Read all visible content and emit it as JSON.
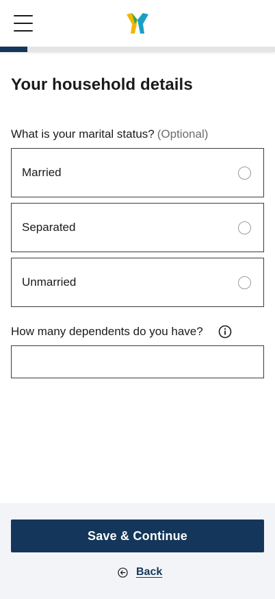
{
  "header": {
    "menu_icon": "hamburger-menu-icon",
    "logo_icon": "brand-logo-icon",
    "progress_fraction": 0.1
  },
  "page": {
    "title": "Your household details"
  },
  "marital": {
    "question": "What is your marital status?",
    "optional": "(Optional)",
    "options": [
      {
        "label": "Married",
        "selected": false
      },
      {
        "label": "Separated",
        "selected": false
      },
      {
        "label": "Unmarried",
        "selected": false
      }
    ]
  },
  "dependents": {
    "question": "How many dependents do you have?",
    "info_icon": "info-icon",
    "value": ""
  },
  "footer": {
    "save_label": "Save & Continue",
    "back_label": "Back",
    "back_icon": "back-arrow-circle-icon"
  },
  "colors": {
    "primary": "#14365a",
    "logo_yellow": "#f2b705",
    "logo_green": "#3aa84a",
    "logo_teal": "#1a9fc4",
    "footer_bg": "#f2f4f7"
  }
}
